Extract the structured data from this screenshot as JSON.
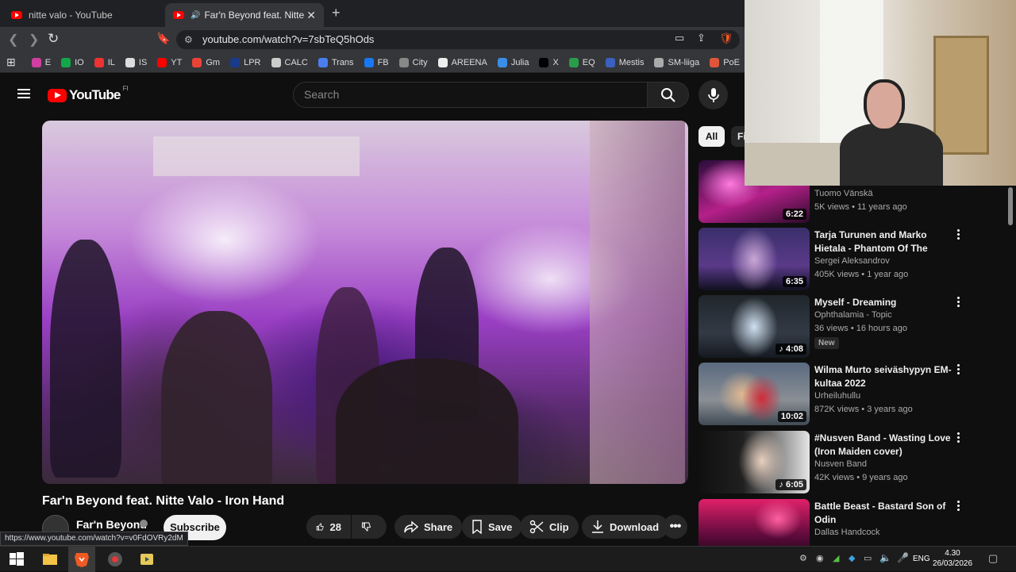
{
  "browser": {
    "tabs": [
      {
        "title": "nitte valo - YouTube",
        "active": false
      },
      {
        "title": "Far'n Beyond feat. Nitte Valo",
        "active": true
      }
    ],
    "url": "youtube.com/watch?v=7sbTeQ5hOds",
    "bookmarks": [
      {
        "label": "E",
        "color": "#d03ea0"
      },
      {
        "label": "IO",
        "color": "#12a84a"
      },
      {
        "label": "IL",
        "color": "#e33"
      },
      {
        "label": "IS",
        "color": "#ddd"
      },
      {
        "label": "YT",
        "color": "#ff0000"
      },
      {
        "label": "Gm",
        "color": "#ea4335"
      },
      {
        "label": "LPR",
        "color": "#1a3a8a"
      },
      {
        "label": "CALC",
        "color": "#ccc"
      },
      {
        "label": "Trans",
        "color": "#4a7ef0"
      },
      {
        "label": "FB",
        "color": "#1877f2"
      },
      {
        "label": "City",
        "color": "#888"
      },
      {
        "label": "AREENA",
        "color": "#eee"
      },
      {
        "label": "Julia",
        "color": "#3b8ee8"
      },
      {
        "label": "X",
        "color": "#000"
      },
      {
        "label": "EQ",
        "color": "#2a9d4a"
      },
      {
        "label": "Mestis",
        "color": "#3a60c0"
      },
      {
        "label": "SM-liiga",
        "color": "#aaa"
      },
      {
        "label": "PoE",
        "color": "#e0553a"
      }
    ],
    "status_url": "https://www.youtube.com/watch?v=v0FdOVRy2dM"
  },
  "youtube": {
    "logo_text": "YouTube",
    "country_code": "FI",
    "search_placeholder": "Search",
    "video": {
      "title": "Far'n Beyond feat. Nitte Valo - Iron Hand",
      "channel": "Far'n Beyond",
      "subscribe_label": "Subscribe",
      "like_count": "28",
      "share_label": "Share",
      "save_label": "Save",
      "clip_label": "Clip",
      "download_label": "Download"
    },
    "chips": {
      "all": "All",
      "next": "Fi"
    },
    "recommendations": [
      {
        "title": "",
        "channel": "Tuomo Vänskä",
        "meta": "5K views • 11 years ago",
        "duration": "6:22",
        "music": false,
        "new": false
      },
      {
        "title": "Tarja Turunen and Marko Hietala - Phantom Of The Oper...",
        "channel": "Sergei Aleksandrov",
        "meta": "405K views • 1 year ago",
        "duration": "6:35",
        "music": false,
        "new": false
      },
      {
        "title": "Myself - Dreaming",
        "channel": "Ophthalamia - Topic",
        "meta": "36 views • 16 hours ago",
        "duration": "4:08",
        "music": true,
        "new": true,
        "new_label": "New"
      },
      {
        "title": "Wilma Murto seiväshypyn EM-kultaa 2022",
        "channel": "Urheiluhullu",
        "meta": "872K views • 3 years ago",
        "duration": "10:02",
        "music": false,
        "new": false
      },
      {
        "title": "#Nusven Band - Wasting Love (Iron Maiden cover)",
        "channel": "Nusven Band",
        "meta": "42K views • 9 years ago",
        "duration": "6:05",
        "music": true,
        "new": false
      },
      {
        "title": "Battle Beast - Bastard Son of Odin",
        "channel": "Dallas Handcock",
        "meta": "",
        "duration": "",
        "music": false,
        "new": false
      }
    ]
  },
  "taskbar": {
    "language": "ENG",
    "time": "4.30",
    "date": "26/03/2026"
  }
}
